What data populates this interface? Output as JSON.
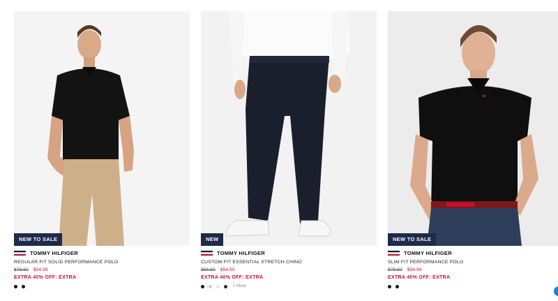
{
  "products": [
    {
      "badge": "NEW TO SALE",
      "brand": "TOMMY HILFIGER",
      "name": "REGULAR FIT SOLID PERFORMANCE POLO",
      "was_price": "$79.50",
      "sale_price": "$54.99",
      "promo": "EXTRA 40% OFF: EXTRA",
      "swatches": [
        "#111111",
        "#111111"
      ],
      "more": ""
    },
    {
      "badge": "NEW",
      "brand": "TOMMY HILFIGER",
      "name": "CUSTOM FIT ESSENTIAL STRETCH CHINO",
      "was_price": "$59.50",
      "sale_price": "$54.50",
      "promo": "EXTRA 40% OFF: EXTRA",
      "swatches": [
        "#111111",
        "#d8cdb6",
        "#e8e8e8",
        "#2a2a2a"
      ],
      "more": "+ More"
    },
    {
      "badge": "NEW TO SALE",
      "brand": "TOMMY HILFIGER",
      "name": "SLIM FIT PERFORMANCE POLO",
      "was_price": "$79.50",
      "sale_price": "$54.99",
      "promo": "EXTRA 40% OFF: EXTRA",
      "swatches": [
        "#111111",
        "#111111"
      ],
      "more": ""
    }
  ],
  "colors": {
    "badge_bg": "#1d2a4b",
    "sale_red": "#c8102e",
    "photo_bg": "#f2f2f2"
  }
}
